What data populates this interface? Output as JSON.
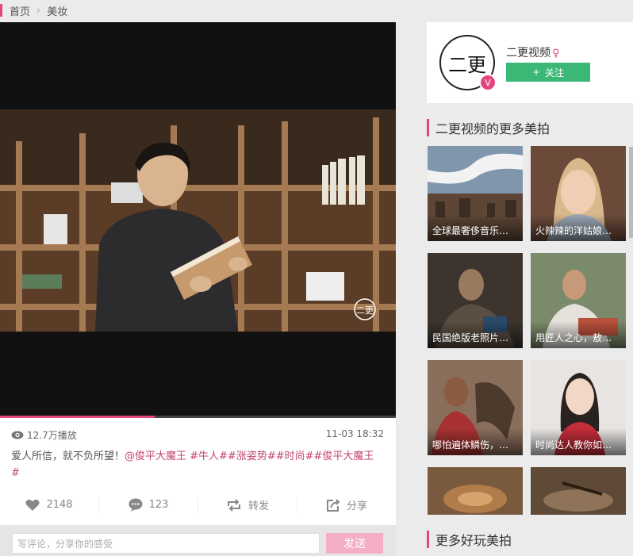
{
  "breadcrumb": {
    "home": "首页",
    "current": "美妆"
  },
  "video": {
    "plays": "12.7万播放",
    "datetime": "11-03 18:32",
    "desc_text": "爱人所信，就不负所望！",
    "desc_tags": "@俊平大魔王 #牛人##涨姿势##时尚##俊平大魔王#",
    "progress": 0.39,
    "likes": "2148",
    "comments": "123",
    "repost": "转发",
    "share": "分享",
    "colors": {
      "accent": "#e5457e",
      "follow": "#3bb776"
    }
  },
  "comment": {
    "placeholder": "写评论，分享你的感受",
    "send": "发送"
  },
  "author": {
    "name": "二更视频",
    "follow": "关注",
    "avatar_glyph": "二更"
  },
  "more": {
    "title": "二更视频的更多美拍",
    "items": [
      {
        "caption": "全球最奢侈音乐…"
      },
      {
        "caption": "火辣辣的洋姑娘…"
      },
      {
        "caption": "民国绝版老照片…"
      },
      {
        "caption": "用匠人之心，敖…"
      },
      {
        "caption": "哪怕遍体鳞伤，…"
      },
      {
        "caption": "时尚达人教你如…"
      },
      {
        "caption": ""
      },
      {
        "caption": ""
      }
    ]
  },
  "fun": {
    "title": "更多好玩美拍"
  }
}
